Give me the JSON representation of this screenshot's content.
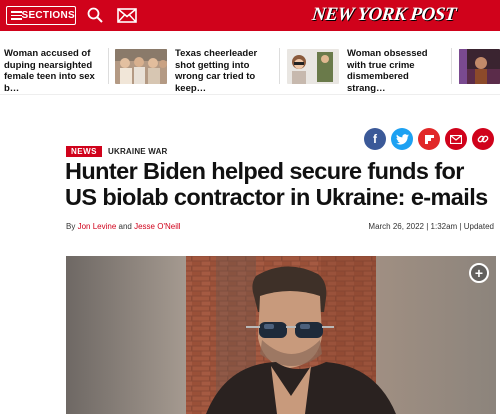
{
  "header": {
    "sections_label": "SECTIONS",
    "logo_text": "NEW YORK POST",
    "brand_color": "#d0021b"
  },
  "trending": [
    {
      "title": "Woman accused of duping nearsighted female teen into sex b…"
    },
    {
      "title": "Texas cheerleader shot getting into wrong car tried to keep…"
    },
    {
      "title": "Woman obsessed with true crime dismembered strang…"
    }
  ],
  "share": {
    "facebook": "f",
    "twitter": "t",
    "flipboard": "f",
    "email": "✉",
    "link": "🔗"
  },
  "article": {
    "category": "NEWS",
    "topic": "UKRAINE WAR",
    "headline": "Hunter Biden helped secure funds for US biolab contractor in Ukraine: e-mails",
    "by": "By",
    "author1": "Jon Levine",
    "and": "and",
    "author2": "Jesse O'Neill",
    "date": "March 26, 2022",
    "time": "1:32am",
    "updated": "Updated",
    "expand_symbol": "+"
  }
}
